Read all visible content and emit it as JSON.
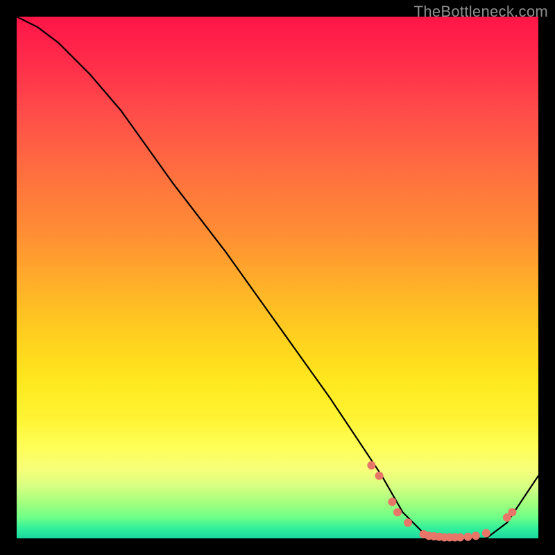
{
  "watermark": "TheBottleneck.com",
  "chart_data": {
    "type": "line",
    "title": "",
    "xlabel": "",
    "ylabel": "",
    "xlim": [
      0,
      100
    ],
    "ylim": [
      0,
      100
    ],
    "grid": false,
    "legend": false,
    "series": [
      {
        "name": "curve",
        "x": [
          0,
          4,
          8,
          14,
          20,
          30,
          40,
          50,
          60,
          66,
          70,
          74,
          78,
          82,
          86,
          90,
          94,
          100
        ],
        "y": [
          100,
          98,
          95,
          89,
          82,
          68,
          55,
          41,
          27,
          18,
          12,
          5,
          1,
          0,
          0,
          0,
          3,
          12
        ]
      }
    ],
    "markers": {
      "name": "highlight-dots",
      "color": "#e77568",
      "points": [
        {
          "x": 68,
          "y": 14
        },
        {
          "x": 69.5,
          "y": 12
        },
        {
          "x": 72,
          "y": 7
        },
        {
          "x": 73,
          "y": 5
        },
        {
          "x": 75,
          "y": 3
        },
        {
          "x": 78,
          "y": 0.8
        },
        {
          "x": 79,
          "y": 0.5
        },
        {
          "x": 80,
          "y": 0.4
        },
        {
          "x": 81,
          "y": 0.3
        },
        {
          "x": 82,
          "y": 0.2
        },
        {
          "x": 83,
          "y": 0.2
        },
        {
          "x": 84,
          "y": 0.2
        },
        {
          "x": 85,
          "y": 0.2
        },
        {
          "x": 86.5,
          "y": 0.3
        },
        {
          "x": 88,
          "y": 0.5
        },
        {
          "x": 90,
          "y": 1
        },
        {
          "x": 94,
          "y": 4
        },
        {
          "x": 95,
          "y": 5
        }
      ]
    }
  }
}
